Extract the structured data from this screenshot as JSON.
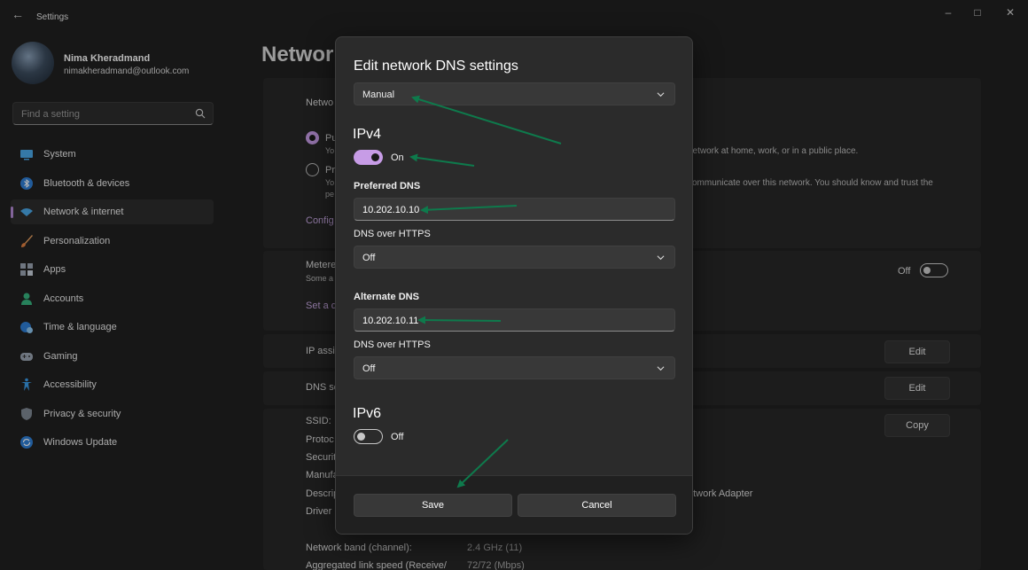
{
  "window": {
    "title": "Settings",
    "controls": [
      "minimize-icon",
      "maximize-icon",
      "close-icon"
    ]
  },
  "profile": {
    "name": "Nima Kheradmand",
    "email": "nimakheradmand@outlook.com"
  },
  "search": {
    "placeholder": "Find a setting"
  },
  "sidebar": {
    "items": [
      {
        "label": "System",
        "icon": "monitor-icon"
      },
      {
        "label": "Bluetooth & devices",
        "icon": "bluetooth-icon"
      },
      {
        "label": "Network & internet",
        "icon": "wifi-icon",
        "active": true
      },
      {
        "label": "Personalization",
        "icon": "brush-icon"
      },
      {
        "label": "Apps",
        "icon": "apps-icon"
      },
      {
        "label": "Accounts",
        "icon": "person-icon"
      },
      {
        "label": "Time & language",
        "icon": "globe-clock-icon"
      },
      {
        "label": "Gaming",
        "icon": "gamepad-icon"
      },
      {
        "label": "Accessibility",
        "icon": "accessibility-icon"
      },
      {
        "label": "Privacy & security",
        "icon": "shield-icon"
      },
      {
        "label": "Windows Update",
        "icon": "update-icon"
      }
    ]
  },
  "page": {
    "title": "Network",
    "profile_heading": "Netwo",
    "public_label": "Pu",
    "public_desc": "Yo",
    "public_desc_right": "network at home, work, or in a public place.",
    "private_label": "Pr",
    "private_desc1": "Yo",
    "private_desc2": "pe",
    "private_desc_right": "communicate over this network. You should know and trust the",
    "configure_link": "Config",
    "metered_label": "Metere",
    "metered_desc": "Some a",
    "metered_toggle": "Off",
    "set_data_link": "Set a d",
    "ip_assignment": "IP assig",
    "dns_server": "DNS se",
    "edit": "Edit",
    "copy": "Copy",
    "props": [
      "SSID:",
      "Protoc",
      "Securit",
      "Manufa",
      "Descrip",
      "Driver"
    ],
    "adapter_right": "etwork Adapter",
    "network_band_label": "Network band (channel):",
    "network_band_value": "2.4 GHz (11)",
    "link_speed_label": "Aggregated link speed (Receive/",
    "link_speed_value": "72/72 (Mbps)"
  },
  "dialog": {
    "title": "Edit network DNS settings",
    "mode": "Manual",
    "ipv4": {
      "heading": "IPv4",
      "state": "On",
      "preferred_label": "Preferred DNS",
      "preferred_value": "10.202.10.10",
      "doh_label_1": "DNS over HTTPS",
      "doh_value_1": "Off",
      "alternate_label": "Alternate DNS",
      "alternate_value": "10.202.10.11",
      "doh_label_2": "DNS over HTTPS",
      "doh_value_2": "Off"
    },
    "ipv6": {
      "heading": "IPv6",
      "state": "Off"
    },
    "save": "Save",
    "cancel": "Cancel"
  },
  "colors": {
    "accent": "#c79ce6",
    "annotation_arrow": "#0e7a4c",
    "background": "#202020",
    "dialog": "#2b2b2b"
  }
}
